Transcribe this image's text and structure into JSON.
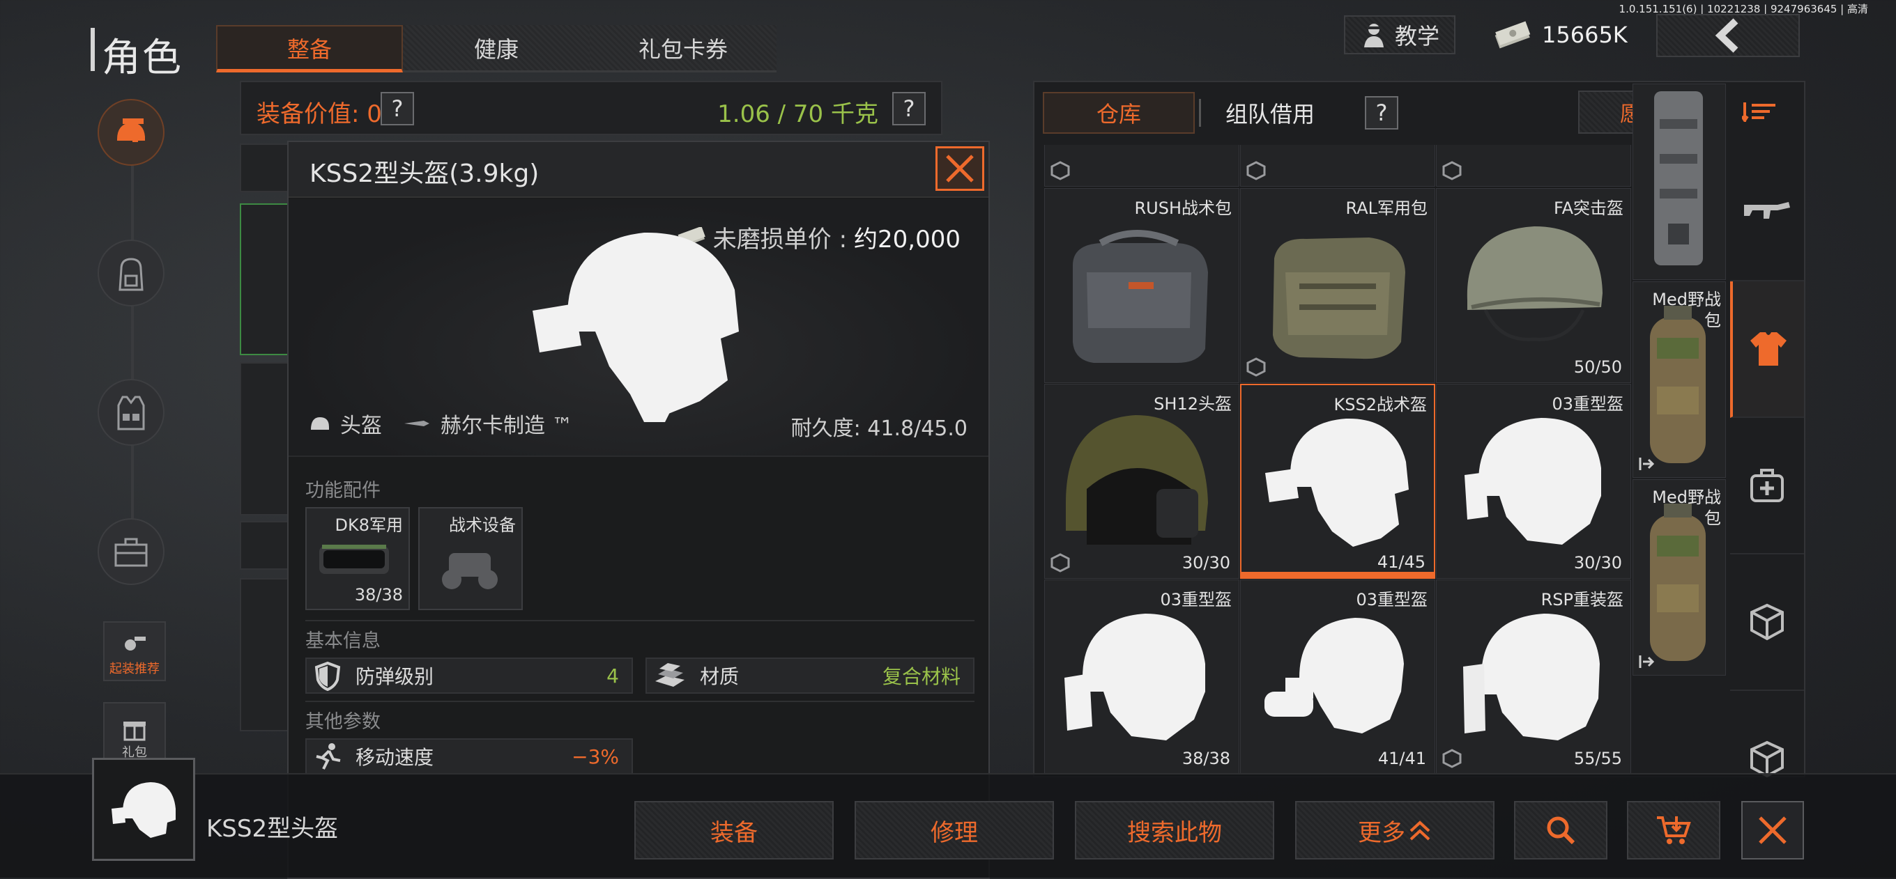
{
  "build_info": "1.0.151.151(6) | 10221238 | 9247963645 | 高清",
  "page_title": "角色",
  "top_tabs": [
    "整备",
    "健康",
    "礼包卡券"
  ],
  "header": {
    "tutorial_label": "教学",
    "money": "15665K"
  },
  "sidebar": {
    "recommend_label": "起装推荐",
    "gift_label": "礼包"
  },
  "value_bar": {
    "value_label": "装备价值: 0",
    "weight_label": "1.06 / 70 千克",
    "help": "?"
  },
  "popup": {
    "title": "KSS2型头盔(3.9kg)",
    "price_label": "未磨损单价 :",
    "price_value": "约20,000",
    "category": "头盔",
    "maker": "赫尔卡制造 ™",
    "durability": "耐久度: 41.8/45.0",
    "section_attachments": "功能配件",
    "attachments": [
      {
        "name": "DK8军用",
        "count": "38/38"
      },
      {
        "name": "战术设备",
        "count": ""
      }
    ],
    "section_basic": "基本信息",
    "armor_label": "防弹级别",
    "armor_value": "4",
    "material_label": "材质",
    "material_value": "复合材料",
    "section_other": "其他参数",
    "speed_label": "移动速度",
    "speed_value": "−3%"
  },
  "warehouse": {
    "tab_storage": "仓库",
    "tab_team": "组队借用",
    "help": "?",
    "wishlist": "愿望单",
    "items": [
      {
        "name": "",
        "count": ""
      },
      {
        "name": "",
        "count": ""
      },
      {
        "name": "",
        "count": ""
      },
      {
        "name": "RUSH战术包",
        "count": ""
      },
      {
        "name": "RAL军用包",
        "count": ""
      },
      {
        "name": "FA突击盔",
        "count": "50/50"
      },
      {
        "name": "SH12头盔",
        "count": "30/30"
      },
      {
        "name": "KSS2战术盔",
        "count": "41/45"
      },
      {
        "name": "03重型盔",
        "count": "30/30"
      },
      {
        "name": "03重型盔",
        "count": "38/38"
      },
      {
        "name": "03重型盔",
        "count": "41/41"
      },
      {
        "name": "RSP重装盔",
        "count": "55/55"
      }
    ],
    "side_items": [
      {
        "name": ""
      },
      {
        "name": "Med野战包"
      },
      {
        "name": "Med野战包"
      }
    ]
  },
  "bottom": {
    "selected_name": "KSS2型头盔",
    "equip": "装备",
    "repair": "修理",
    "search": "搜索此物",
    "more": "更多"
  },
  "colors": {
    "accent": "#ee6a2c",
    "positive": "#9ac24a",
    "negative": "#ee6a2c"
  },
  "icons": [
    "gun-helmet-icon",
    "backpack-icon",
    "vest-icon",
    "toolbox-icon",
    "recommend-icon",
    "gift-icon",
    "rifle-icon",
    "shirt-icon",
    "medkit-icon",
    "box-icon",
    "search-icon",
    "cart-icon",
    "close-icon",
    "back-arrow-icon",
    "sort-icon"
  ]
}
